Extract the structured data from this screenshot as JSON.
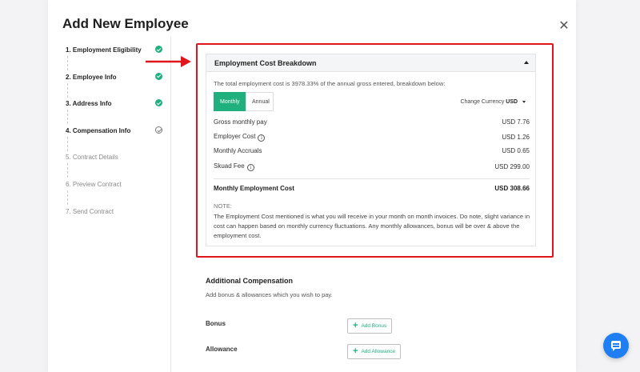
{
  "modal": {
    "title": "Add New Employee",
    "close_icon": "close-icon"
  },
  "steps": [
    {
      "label": "1. Employment Eligibility",
      "status": "done"
    },
    {
      "label": "2. Employee Info",
      "status": "done"
    },
    {
      "label": "3. Address Info",
      "status": "done"
    },
    {
      "label": "4. Compensation Info",
      "status": "pending"
    },
    {
      "label": "5. Contract Details",
      "status": "todo"
    },
    {
      "label": "6. Preview Contract",
      "status": "todo"
    },
    {
      "label": "7. Send Contract",
      "status": "todo"
    }
  ],
  "cost_breakdown": {
    "title": "Employment Cost Breakdown",
    "intro": "The total employment cost is 3978.33% of the annual gross entered, breakdown below:",
    "toggle": {
      "monthly": "Monthly",
      "annual": "Annual",
      "selected": "Monthly"
    },
    "currency": {
      "label": "Change Currency",
      "value": "USD"
    },
    "rows": [
      {
        "label": "Gross monthly pay",
        "value": "USD 7.76"
      },
      {
        "label": "Employer Cost",
        "value": "USD 1.26"
      },
      {
        "label": "Monthly Accruals",
        "value": "USD 0.65"
      },
      {
        "label": "Skuad Fee",
        "value": "USD 299.00"
      }
    ],
    "total": {
      "label": "Monthly Employment Cost",
      "value": "USD 308.66"
    },
    "note_label": "NOTE:",
    "note_text": "The Employment Cost mentioned is what you will receive in your month on month invoices. Do note, slight variance in cost can happen based on monthly currency fluctuations. Any monthly allowances, bonus will be over & above the employment cost."
  },
  "additional": {
    "title": "Additional Compensation",
    "subtitle": "Add bonus & allowances which you wish to pay.",
    "bonus_label": "Bonus",
    "bonus_button": "Add Bonus",
    "allowance_label": "Allowance",
    "allowance_button": "Add Allowance"
  },
  "colors": {
    "accent": "#1fb07e",
    "highlight": "#e0161d",
    "chat": "#1f7ef2"
  }
}
